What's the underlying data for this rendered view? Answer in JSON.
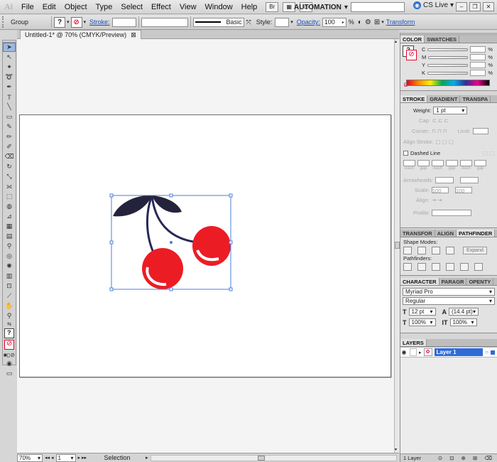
{
  "menubar": {
    "logo": "Ai",
    "items": [
      "File",
      "Edit",
      "Object",
      "Type",
      "Select",
      "Effect",
      "View",
      "Window",
      "Help"
    ],
    "workspace": "AUTOMATION",
    "cs_live": "CS Live"
  },
  "control": {
    "selection_label": "Group",
    "stroke_label": "Stroke:",
    "brush_label": "Basic",
    "style_label": "Style:",
    "opacity_label": "Opacity:",
    "opacity_value": "100",
    "opacity_unit": "%",
    "transform_label": "Transform"
  },
  "document": {
    "tab_title": "Untitled-1* @ 70% (CMYK/Preview)",
    "tab_close": "⊠"
  },
  "status": {
    "zoom": "70%",
    "artboard": "1",
    "tool": "Selection"
  },
  "color_panel": {
    "tabs": [
      "COLOR",
      "SWATCHES"
    ],
    "channels": [
      {
        "name": "C",
        "unit": "%"
      },
      {
        "name": "M",
        "unit": "%"
      },
      {
        "name": "Y",
        "unit": "%"
      },
      {
        "name": "K",
        "unit": "%"
      }
    ]
  },
  "stroke_panel": {
    "tabs": [
      "STROKE",
      "GRADIENT",
      "TRANSPA"
    ],
    "weight_label": "Weight:",
    "weight_value": "1 pt",
    "cap_label": "Cap:",
    "corner_label": "Corner:",
    "limit_label": "Limit:",
    "align_label": "Align Stroke:",
    "dashed_label": "Dashed Line",
    "dash_labels": [
      "dash",
      "gap",
      "dash",
      "gap",
      "dash",
      "gap"
    ],
    "arrowheads_label": "Arrowheads:",
    "scale_label": "Scale:",
    "scale_values": [
      "100",
      "100"
    ],
    "align2_label": "Align:",
    "profile_label": "Profile:"
  },
  "pathfinder_panel": {
    "tabs": [
      "TRANSFOR",
      "ALIGN",
      "PATHFINDER"
    ],
    "shape_modes_label": "Shape Modes:",
    "expand_label": "Expand",
    "pathfinders_label": "Pathfinders:"
  },
  "character_panel": {
    "tabs": [
      "CHARACTER",
      "PARAGR",
      "OPENTY"
    ],
    "font": "Myriad Pro",
    "style": "Regular",
    "size": "12 pt",
    "leading": "(14.4 pt)",
    "hscale": "100%",
    "vscale": "100%"
  },
  "layers_panel": {
    "tab": "LAYERS",
    "layer_name": "Layer 1",
    "footer": "1 Layer"
  },
  "artwork": {
    "cherry_color": "#ec1c24",
    "leaf_color": "#25233b",
    "stem_color": "#27285a",
    "selection_color": "#4a7fd8"
  }
}
